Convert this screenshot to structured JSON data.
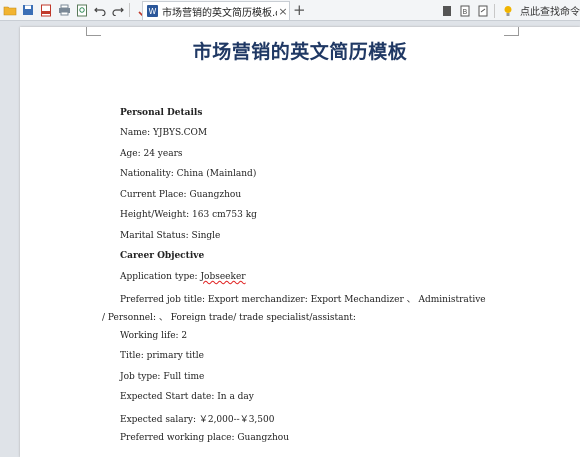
{
  "toolbar": {
    "icons": [
      "folder-icon",
      "save-icon",
      "pdf-icon",
      "print-icon",
      "preview-icon",
      "undo-icon",
      "redo-icon",
      "format-painter-icon",
      "wps-logo-icon"
    ],
    "tab": {
      "label": "市场营销的英文简历模板.docx",
      "close": "×"
    },
    "add_tab": "+",
    "find_command": "点此查找命令"
  },
  "document": {
    "title": "市场营销的英文简历模板",
    "lines": [
      {
        "text": "Personal Details",
        "bold": true
      },
      {
        "text": "Name: YJBYS.COM"
      },
      {
        "text": "Age: 24 years"
      },
      {
        "text": "Nationality: China (Mainland)"
      },
      {
        "text": "Current Place: Guangzhou"
      },
      {
        "text": "Height/Weight: 163 cm753 kg"
      },
      {
        "text": "Marital Status: Single"
      },
      {
        "text": "Career Objective",
        "bold": true
      },
      {
        "text_a": "Application type: ",
        "text_b": "Jobseeker"
      },
      {
        "text": "Preferred job title: Export merchandizer: Export Mechandizer  、 Administrative"
      },
      {
        "text": "/ Personnel: 、 Foreign trade/ trade specialist/assistant:"
      },
      {
        "text": "Working life: 2"
      },
      {
        "text": "Title: primary title"
      },
      {
        "text": "Job type: Full time"
      },
      {
        "text": "Expected Start date: In a day"
      },
      {
        "text": "Expected salary: ￥2,000--￥3,500"
      },
      {
        "text": "Preferred working place: Guangzhou"
      }
    ]
  }
}
